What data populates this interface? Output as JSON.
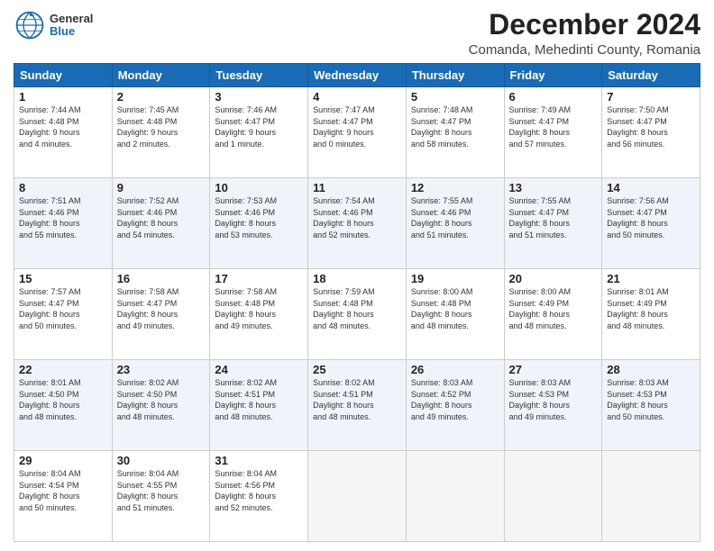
{
  "header": {
    "logo_general": "General",
    "logo_blue": "Blue",
    "month_title": "December 2024",
    "location": "Comanda, Mehedinti County, Romania"
  },
  "days_of_week": [
    "Sunday",
    "Monday",
    "Tuesday",
    "Wednesday",
    "Thursday",
    "Friday",
    "Saturday"
  ],
  "weeks": [
    [
      {
        "day": "1",
        "info": "Sunrise: 7:44 AM\nSunset: 4:48 PM\nDaylight: 9 hours\nand 4 minutes."
      },
      {
        "day": "2",
        "info": "Sunrise: 7:45 AM\nSunset: 4:48 PM\nDaylight: 9 hours\nand 2 minutes."
      },
      {
        "day": "3",
        "info": "Sunrise: 7:46 AM\nSunset: 4:47 PM\nDaylight: 9 hours\nand 1 minute."
      },
      {
        "day": "4",
        "info": "Sunrise: 7:47 AM\nSunset: 4:47 PM\nDaylight: 9 hours\nand 0 minutes."
      },
      {
        "day": "5",
        "info": "Sunrise: 7:48 AM\nSunset: 4:47 PM\nDaylight: 8 hours\nand 58 minutes."
      },
      {
        "day": "6",
        "info": "Sunrise: 7:49 AM\nSunset: 4:47 PM\nDaylight: 8 hours\nand 57 minutes."
      },
      {
        "day": "7",
        "info": "Sunrise: 7:50 AM\nSunset: 4:47 PM\nDaylight: 8 hours\nand 56 minutes."
      }
    ],
    [
      {
        "day": "8",
        "info": "Sunrise: 7:51 AM\nSunset: 4:46 PM\nDaylight: 8 hours\nand 55 minutes."
      },
      {
        "day": "9",
        "info": "Sunrise: 7:52 AM\nSunset: 4:46 PM\nDaylight: 8 hours\nand 54 minutes."
      },
      {
        "day": "10",
        "info": "Sunrise: 7:53 AM\nSunset: 4:46 PM\nDaylight: 8 hours\nand 53 minutes."
      },
      {
        "day": "11",
        "info": "Sunrise: 7:54 AM\nSunset: 4:46 PM\nDaylight: 8 hours\nand 52 minutes."
      },
      {
        "day": "12",
        "info": "Sunrise: 7:55 AM\nSunset: 4:46 PM\nDaylight: 8 hours\nand 51 minutes."
      },
      {
        "day": "13",
        "info": "Sunrise: 7:55 AM\nSunset: 4:47 PM\nDaylight: 8 hours\nand 51 minutes."
      },
      {
        "day": "14",
        "info": "Sunrise: 7:56 AM\nSunset: 4:47 PM\nDaylight: 8 hours\nand 50 minutes."
      }
    ],
    [
      {
        "day": "15",
        "info": "Sunrise: 7:57 AM\nSunset: 4:47 PM\nDaylight: 8 hours\nand 50 minutes."
      },
      {
        "day": "16",
        "info": "Sunrise: 7:58 AM\nSunset: 4:47 PM\nDaylight: 8 hours\nand 49 minutes."
      },
      {
        "day": "17",
        "info": "Sunrise: 7:58 AM\nSunset: 4:48 PM\nDaylight: 8 hours\nand 49 minutes."
      },
      {
        "day": "18",
        "info": "Sunrise: 7:59 AM\nSunset: 4:48 PM\nDaylight: 8 hours\nand 48 minutes."
      },
      {
        "day": "19",
        "info": "Sunrise: 8:00 AM\nSunset: 4:48 PM\nDaylight: 8 hours\nand 48 minutes."
      },
      {
        "day": "20",
        "info": "Sunrise: 8:00 AM\nSunset: 4:49 PM\nDaylight: 8 hours\nand 48 minutes."
      },
      {
        "day": "21",
        "info": "Sunrise: 8:01 AM\nSunset: 4:49 PM\nDaylight: 8 hours\nand 48 minutes."
      }
    ],
    [
      {
        "day": "22",
        "info": "Sunrise: 8:01 AM\nSunset: 4:50 PM\nDaylight: 8 hours\nand 48 minutes."
      },
      {
        "day": "23",
        "info": "Sunrise: 8:02 AM\nSunset: 4:50 PM\nDaylight: 8 hours\nand 48 minutes."
      },
      {
        "day": "24",
        "info": "Sunrise: 8:02 AM\nSunset: 4:51 PM\nDaylight: 8 hours\nand 48 minutes."
      },
      {
        "day": "25",
        "info": "Sunrise: 8:02 AM\nSunset: 4:51 PM\nDaylight: 8 hours\nand 48 minutes."
      },
      {
        "day": "26",
        "info": "Sunrise: 8:03 AM\nSunset: 4:52 PM\nDaylight: 8 hours\nand 49 minutes."
      },
      {
        "day": "27",
        "info": "Sunrise: 8:03 AM\nSunset: 4:53 PM\nDaylight: 8 hours\nand 49 minutes."
      },
      {
        "day": "28",
        "info": "Sunrise: 8:03 AM\nSunset: 4:53 PM\nDaylight: 8 hours\nand 50 minutes."
      }
    ],
    [
      {
        "day": "29",
        "info": "Sunrise: 8:04 AM\nSunset: 4:54 PM\nDaylight: 8 hours\nand 50 minutes."
      },
      {
        "day": "30",
        "info": "Sunrise: 8:04 AM\nSunset: 4:55 PM\nDaylight: 8 hours\nand 51 minutes."
      },
      {
        "day": "31",
        "info": "Sunrise: 8:04 AM\nSunset: 4:56 PM\nDaylight: 8 hours\nand 52 minutes."
      },
      {
        "day": "",
        "info": ""
      },
      {
        "day": "",
        "info": ""
      },
      {
        "day": "",
        "info": ""
      },
      {
        "day": "",
        "info": ""
      }
    ]
  ]
}
